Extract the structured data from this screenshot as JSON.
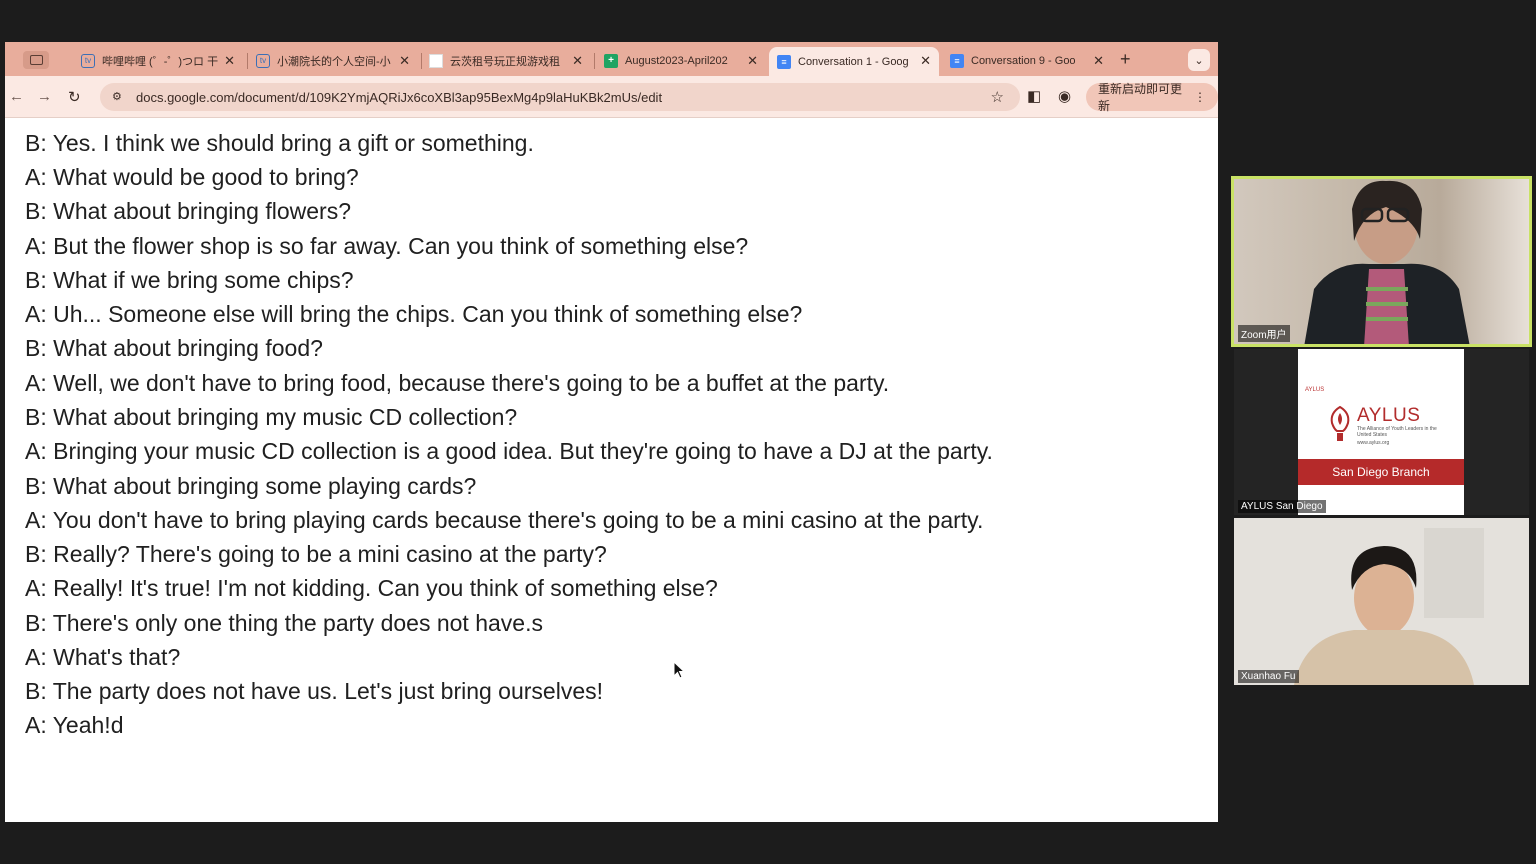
{
  "browser": {
    "tabs": [
      {
        "title": "哔哩哔哩 (゜-゜)つロ 干",
        "icon": "bilibili-icon",
        "active": false
      },
      {
        "title": "小潮院长的个人空间-小",
        "icon": "bilibili-icon",
        "active": false
      },
      {
        "title": "云茨租号玩正规游戏租",
        "icon": "blank-page-icon",
        "active": false
      },
      {
        "title": "August2023-April202",
        "icon": "google-sheets-icon",
        "active": false
      },
      {
        "title": "Conversation 1 - Goog",
        "icon": "google-docs-icon",
        "active": true
      },
      {
        "title": "Conversation 9 - Goo",
        "icon": "google-docs-icon",
        "active": false
      }
    ],
    "new_tab": "+",
    "url": "docs.google.com/document/d/109K2YmjAQRiJx6coXBl3ap95BexMg4p9laHuKBk2mUs/edit",
    "update_button": "重新启动即可更新",
    "accent_color": "#e8ad9c"
  },
  "document": {
    "lines": [
      "B: Yes. I think we should bring a gift or something.",
      "A: What would be good to bring?",
      "B: What about bringing flowers?",
      "A: But the flower shop is so far away. Can you think of something else?",
      "B: What if we bring some chips?",
      "A: Uh... Someone else will bring the chips. Can you think of something else?",
      "B: What about bringing food?",
      "A: Well, we don't have to bring food, because there's going to be a buffet at the party.",
      "B: What about bringing my music CD collection?",
      "A: Bringing your music CD collection is a good idea. But they're going to have a DJ at the party.",
      "B: What about bringing some playing cards?",
      "A: You don't have to bring playing cards because there's going to be a mini casino at the party.",
      "B: Really? There's going to be a mini casino at the party?",
      "A: Really! It's true! I'm not kidding. Can you think of something else?",
      "B: There's only one thing the party does not have.s",
      "A: What's that?",
      "B: The party does not have us. Let's just bring ourselves!",
      "A: Yeah!d"
    ]
  },
  "participants": [
    {
      "name": "Zoom用户",
      "active_speaker": true
    },
    {
      "name": "AYLUS San Diego",
      "active_speaker": false,
      "card": {
        "small_label": "AYLUS",
        "title": "AYLUS",
        "subtitle": "The Alliance of Youth Leaders in the United States",
        "site": "www.aylus.org",
        "branch": "San Diego Branch"
      }
    },
    {
      "name": "Xuanhao Fu",
      "active_speaker": false
    }
  ]
}
